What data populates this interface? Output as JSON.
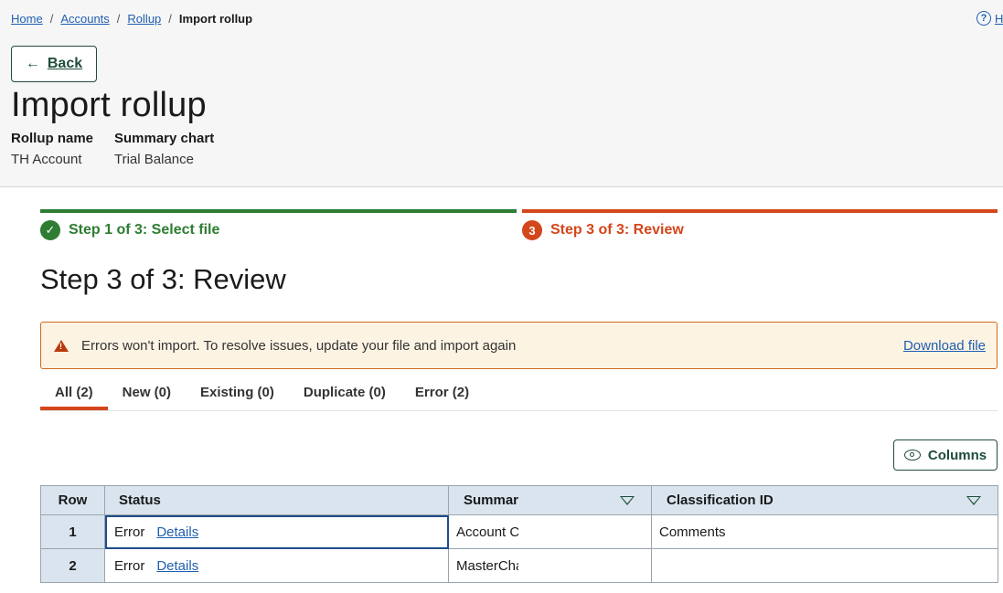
{
  "breadcrumb": {
    "home": "Home",
    "accounts": "Accounts",
    "rollup": "Rollup",
    "current": "Import rollup",
    "separator": "/"
  },
  "help": {
    "label": "H"
  },
  "back": {
    "label": "Back"
  },
  "page": {
    "title": "Import rollup",
    "rollup_name_label": "Rollup name",
    "rollup_name_value": "TH Account",
    "summary_chart_label": "Summary chart",
    "summary_chart_value": "Trial Balance"
  },
  "steps": {
    "step1": {
      "label": "Step 1 of 3: Select file",
      "status": "complete",
      "color": "#2e7d32"
    },
    "step3": {
      "label": "Step 3 of 3: Review",
      "number": "3",
      "status": "current",
      "color": "#d4461b"
    }
  },
  "section": {
    "title": "Step 3 of 3: Review"
  },
  "alert": {
    "text": "Errors won't import. To resolve issues, update your file and import again",
    "link": "Download file"
  },
  "tabs": [
    {
      "label": "All (2)",
      "active": true
    },
    {
      "label": "New (0)"
    },
    {
      "label": "Existing (0)"
    },
    {
      "label": "Duplicate (0)"
    },
    {
      "label": "Error (2)"
    }
  ],
  "columns_button": {
    "label": "Columns"
  },
  "table": {
    "headers": {
      "row": "Row",
      "status": "Status",
      "summary": "Summar",
      "classification": "Classification ID"
    },
    "rows": [
      {
        "row": "1",
        "status": "Error",
        "details": "Details",
        "summary": "Account C",
        "classification": "Comments"
      },
      {
        "row": "2",
        "status": "Error",
        "details": "Details",
        "summary": "MasterCha",
        "classification": ""
      }
    ]
  }
}
